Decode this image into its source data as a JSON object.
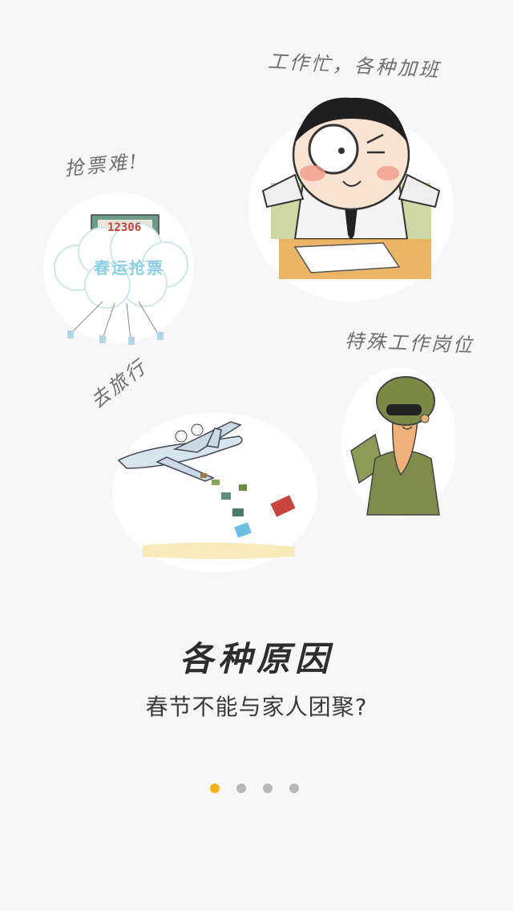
{
  "captions": {
    "work": "工作忙，各种加班",
    "ticket": "抢票难!",
    "special": "特殊工作岗位",
    "travel": "去旅行"
  },
  "ticket_card": {
    "number": "12306",
    "cloud_text": "春运抢票"
  },
  "headline": "各种原因",
  "subline": "春节不能与家人团聚?",
  "pager": {
    "pages": 4,
    "active_index": 0,
    "active_color": "#f4b21e",
    "inactive_color": "#b8b8b8"
  }
}
